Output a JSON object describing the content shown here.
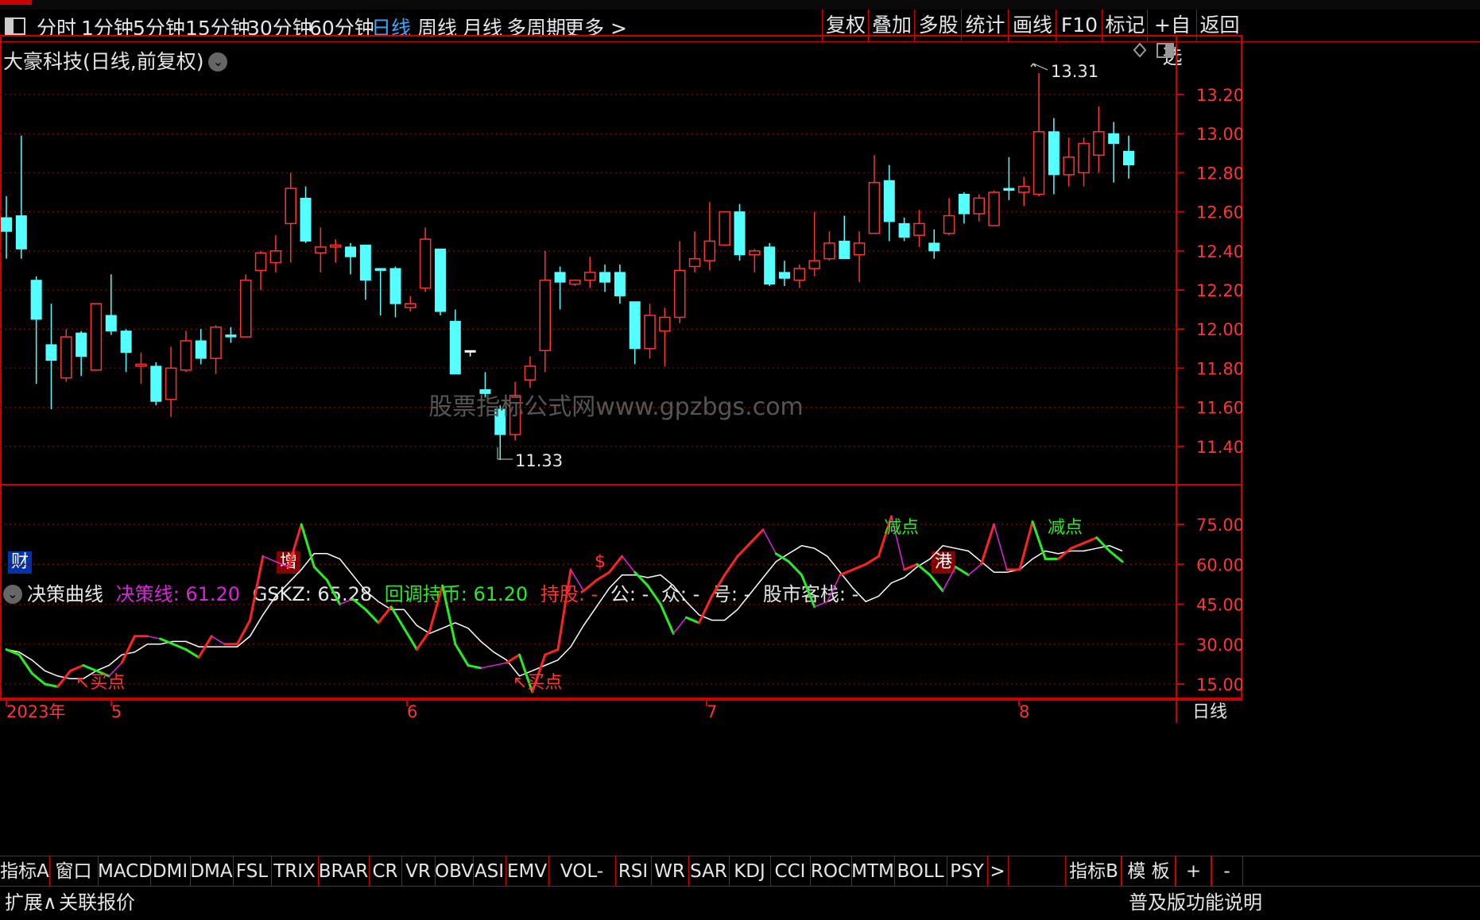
{
  "menubar": {
    "items": [
      "分时",
      "1分钟",
      "5分钟",
      "15分钟",
      "30分钟",
      "60分钟",
      "日线",
      "周线",
      "月线",
      "多周期",
      "更多 >"
    ],
    "active": "日线",
    "right_buttons": [
      "复权",
      "叠加",
      "多股",
      "统计",
      "画线",
      "F10",
      "标记",
      "+自选",
      "返回"
    ]
  },
  "main_chart": {
    "title": "大豪科技(日线,前复权)",
    "high_label": "13.31",
    "low_label": "11.33",
    "watermark": "股票指标公式网www.gpzbgs.com",
    "y_ticks": [
      "13.20",
      "13.00",
      "12.80",
      "12.60",
      "12.40",
      "12.20",
      "12.00",
      "11.80",
      "11.60",
      "11.40"
    ],
    "flags": [
      {
        "text": "财",
        "color": "#3366ff"
      },
      {
        "text": "增",
        "color": "#c00000"
      },
      {
        "text": "$",
        "color": "#c00000"
      },
      {
        "text": "港",
        "color": "#c00000"
      }
    ]
  },
  "indicator": {
    "name": "决策曲线",
    "fields": [
      {
        "label": "决策线: 61.20",
        "color": "#dd22dd"
      },
      {
        "label": "GSKZ: 65.28",
        "color": "#e6e6e6"
      },
      {
        "label": "回调持币: 61.20",
        "color": "#22ee22"
      },
      {
        "label": "持股: -",
        "color": "#ff3333"
      },
      {
        "label": "公: -",
        "color": "#e6e6e6"
      },
      {
        "label": "众: -",
        "color": "#e6e6e6"
      },
      {
        "label": "号: -",
        "color": "#e6e6e6"
      },
      {
        "label": "股市客栈: -",
        "color": "#e6e6e6"
      }
    ],
    "y_ticks": [
      "75.00",
      "60.00",
      "45.00",
      "30.00",
      "15.00"
    ],
    "annotations": [
      {
        "text": "↖买点",
        "color": "#ff3333"
      },
      {
        "text": "↖买点",
        "color": "#ff3333"
      },
      {
        "text": "减点",
        "color": "#22ee22"
      },
      {
        "text": "减点",
        "color": "#22ee22"
      }
    ]
  },
  "x_axis": {
    "labels": [
      "2023年",
      "5",
      "6",
      "7",
      "8"
    ],
    "period_label": "日线"
  },
  "bottom_tabs": [
    "指标A",
    "窗口",
    "MACD",
    "DMI",
    "DMA",
    "FSL",
    "TRIX",
    "BRAR",
    "CR",
    "VR",
    "OBV",
    "ASI",
    "EMV",
    "VOL-TDX",
    "RSI",
    "WR",
    "SAR",
    "KDJ",
    "CCI",
    "ROC",
    "MTM",
    "BOLL",
    "PSY",
    ">"
  ],
  "bottom_right_tabs": [
    "指标B",
    "模 板",
    "+",
    "-"
  ],
  "status_bar": {
    "left": [
      "扩展∧",
      "关联报价"
    ],
    "right": "普及版功能说明"
  },
  "colors": {
    "up": "#ff3333",
    "down": "#54ffff",
    "grid": "#7a0000",
    "border": "#cc0000"
  },
  "chart_data": {
    "type": "candlestick",
    "ylim": [
      11.2,
      13.4
    ],
    "candles": [
      {
        "o": 12.57,
        "c": 12.5,
        "h": 12.68,
        "l": 12.36
      },
      {
        "o": 12.58,
        "c": 12.41,
        "h": 12.99,
        "l": 12.36
      },
      {
        "o": 12.25,
        "c": 12.05,
        "h": 12.27,
        "l": 11.72
      },
      {
        "o": 11.92,
        "c": 11.84,
        "h": 12.13,
        "l": 11.59
      },
      {
        "o": 11.75,
        "c": 11.96,
        "h": 12.0,
        "l": 11.73
      },
      {
        "o": 11.98,
        "c": 11.86,
        "h": 11.99,
        "l": 11.76
      },
      {
        "o": 11.79,
        "c": 12.13,
        "h": 12.13,
        "l": 11.79
      },
      {
        "o": 12.07,
        "c": 11.99,
        "h": 12.28,
        "l": 11.97
      },
      {
        "o": 11.99,
        "c": 11.88,
        "h": 12.0,
        "l": 11.78
      },
      {
        "o": 11.81,
        "c": 11.82,
        "h": 11.88,
        "l": 11.72
      },
      {
        "o": 11.81,
        "c": 11.63,
        "h": 11.83,
        "l": 11.61
      },
      {
        "o": 11.64,
        "c": 11.8,
        "h": 11.91,
        "l": 11.55
      },
      {
        "o": 11.79,
        "c": 11.94,
        "h": 11.99,
        "l": 11.78
      },
      {
        "o": 11.94,
        "c": 11.85,
        "h": 12.0,
        "l": 11.82
      },
      {
        "o": 11.85,
        "c": 12.01,
        "h": 12.02,
        "l": 11.77
      },
      {
        "o": 11.97,
        "c": 11.96,
        "h": 12.01,
        "l": 11.93
      },
      {
        "o": 11.96,
        "c": 12.25,
        "h": 12.28,
        "l": 11.96
      },
      {
        "o": 12.3,
        "c": 12.39,
        "h": 12.4,
        "l": 12.2
      },
      {
        "o": 12.34,
        "c": 12.4,
        "h": 12.48,
        "l": 12.29
      },
      {
        "o": 12.54,
        "c": 12.72,
        "h": 12.8,
        "l": 12.34
      },
      {
        "o": 12.67,
        "c": 12.45,
        "h": 12.73,
        "l": 12.44
      },
      {
        "o": 12.39,
        "c": 12.42,
        "h": 12.52,
        "l": 12.29
      },
      {
        "o": 12.42,
        "c": 12.43,
        "h": 12.46,
        "l": 12.34
      },
      {
        "o": 12.42,
        "c": 12.37,
        "h": 12.44,
        "l": 12.28
      },
      {
        "o": 12.43,
        "c": 12.25,
        "h": 12.43,
        "l": 12.15
      },
      {
        "o": 12.31,
        "c": 12.3,
        "h": 12.31,
        "l": 12.07
      },
      {
        "o": 12.31,
        "c": 12.13,
        "h": 12.32,
        "l": 12.06
      },
      {
        "o": 12.11,
        "c": 12.13,
        "h": 12.17,
        "l": 12.09
      },
      {
        "o": 12.21,
        "c": 12.46,
        "h": 12.52,
        "l": 12.19
      },
      {
        "o": 12.41,
        "c": 12.09,
        "h": 12.41,
        "l": 12.07
      },
      {
        "o": 12.04,
        "c": 11.77,
        "h": 12.1,
        "l": 11.77
      },
      {
        "o": 11.89,
        "c": 11.89,
        "h": 11.82,
        "l": 11.86
      },
      {
        "o": 11.69,
        "c": 11.67,
        "h": 11.78,
        "l": 11.65
      },
      {
        "o": 11.59,
        "c": 11.46,
        "h": 11.61,
        "l": 11.33
      },
      {
        "o": 11.46,
        "c": 11.66,
        "h": 11.73,
        "l": 11.43
      },
      {
        "o": 11.74,
        "c": 11.81,
        "h": 11.86,
        "l": 11.7
      },
      {
        "o": 11.89,
        "c": 12.25,
        "h": 12.4,
        "l": 11.78
      },
      {
        "o": 12.29,
        "c": 12.24,
        "h": 12.32,
        "l": 12.1
      },
      {
        "o": 12.23,
        "c": 12.25,
        "h": 12.25,
        "l": 12.22
      },
      {
        "o": 12.25,
        "c": 12.29,
        "h": 12.37,
        "l": 12.21
      },
      {
        "o": 12.29,
        "c": 12.24,
        "h": 12.33,
        "l": 12.19
      },
      {
        "o": 12.29,
        "c": 12.17,
        "h": 12.33,
        "l": 12.13
      },
      {
        "o": 12.14,
        "c": 11.9,
        "h": 12.14,
        "l": 11.82
      },
      {
        "o": 11.9,
        "c": 12.07,
        "h": 12.13,
        "l": 11.85
      },
      {
        "o": 11.99,
        "c": 12.06,
        "h": 12.11,
        "l": 11.81
      },
      {
        "o": 12.06,
        "c": 12.3,
        "h": 12.45,
        "l": 12.03
      },
      {
        "o": 12.32,
        "c": 12.36,
        "h": 12.5,
        "l": 12.29
      },
      {
        "o": 12.35,
        "c": 12.45,
        "h": 12.65,
        "l": 12.3
      },
      {
        "o": 12.43,
        "c": 12.6,
        "h": 12.6,
        "l": 12.43
      },
      {
        "o": 12.6,
        "c": 12.38,
        "h": 12.64,
        "l": 12.35
      },
      {
        "o": 12.38,
        "c": 12.4,
        "h": 12.41,
        "l": 12.29
      },
      {
        "o": 12.42,
        "c": 12.23,
        "h": 12.44,
        "l": 12.22
      },
      {
        "o": 12.29,
        "c": 12.26,
        "h": 12.35,
        "l": 12.22
      },
      {
        "o": 12.25,
        "c": 12.31,
        "h": 12.33,
        "l": 12.21
      },
      {
        "o": 12.31,
        "c": 12.35,
        "h": 12.6,
        "l": 12.27
      },
      {
        "o": 12.36,
        "c": 12.44,
        "h": 12.5,
        "l": 12.35
      },
      {
        "o": 12.45,
        "c": 12.36,
        "h": 12.58,
        "l": 12.36
      },
      {
        "o": 12.38,
        "c": 12.44,
        "h": 12.5,
        "l": 12.24
      },
      {
        "o": 12.49,
        "c": 12.75,
        "h": 12.89,
        "l": 12.49
      },
      {
        "o": 12.76,
        "c": 12.55,
        "h": 12.84,
        "l": 12.45
      },
      {
        "o": 12.54,
        "c": 12.47,
        "h": 12.57,
        "l": 12.45
      },
      {
        "o": 12.48,
        "c": 12.54,
        "h": 12.61,
        "l": 12.42
      },
      {
        "o": 12.44,
        "c": 12.4,
        "h": 12.51,
        "l": 12.36
      },
      {
        "o": 12.49,
        "c": 12.58,
        "h": 12.67,
        "l": 12.48
      },
      {
        "o": 12.69,
        "c": 12.59,
        "h": 12.7,
        "l": 12.54
      },
      {
        "o": 12.59,
        "c": 12.67,
        "h": 12.69,
        "l": 12.55
      },
      {
        "o": 12.53,
        "c": 12.7,
        "h": 12.71,
        "l": 12.53
      },
      {
        "o": 12.72,
        "c": 12.71,
        "h": 12.88,
        "l": 12.66
      },
      {
        "o": 12.7,
        "c": 12.73,
        "h": 12.78,
        "l": 12.63
      },
      {
        "o": 12.69,
        "c": 13.01,
        "h": 13.31,
        "l": 12.68
      },
      {
        "o": 13.01,
        "c": 12.79,
        "h": 13.08,
        "l": 12.69
      },
      {
        "o": 12.79,
        "c": 12.88,
        "h": 12.98,
        "l": 12.73
      },
      {
        "o": 12.8,
        "c": 12.95,
        "h": 12.98,
        "l": 12.73
      },
      {
        "o": 12.89,
        "c": 13.01,
        "h": 13.14,
        "l": 12.8
      },
      {
        "o": 13.0,
        "c": 12.95,
        "h": 13.06,
        "l": 12.75
      },
      {
        "o": 12.91,
        "c": 12.84,
        "h": 12.99,
        "l": 12.77
      }
    ],
    "indicator_series": {
      "ylim": [
        10,
        85
      ],
      "decision_line": [
        28,
        26,
        19,
        15,
        14,
        20,
        22,
        20,
        18,
        23,
        33,
        33,
        32,
        30,
        28,
        25,
        33,
        30,
        30,
        39,
        63,
        61,
        59,
        75,
        59,
        54,
        45,
        47,
        43,
        38,
        44,
        36,
        28,
        35,
        52,
        30,
        22,
        21,
        22,
        23,
        26,
        12,
        26,
        28,
        58,
        50,
        54,
        57,
        63,
        57,
        52,
        45,
        34,
        40,
        38,
        48,
        56,
        63,
        68,
        73,
        64,
        61,
        56,
        44,
        46,
        56,
        58,
        60,
        63,
        78,
        58,
        60,
        56,
        50,
        59,
        56,
        60,
        75,
        58,
        58,
        76,
        62,
        62,
        66,
        68,
        70,
        65,
        61
      ],
      "gskz": [
        28,
        27,
        24,
        20,
        18,
        17,
        17,
        20,
        22,
        26,
        27,
        30,
        30,
        31,
        31,
        29,
        29,
        29,
        29,
        33,
        41,
        48,
        53,
        58,
        64,
        64,
        62,
        56,
        50,
        46,
        43,
        43,
        37,
        34,
        36,
        38,
        36,
        31,
        27,
        24,
        18,
        20,
        22,
        24,
        29,
        37,
        44,
        51,
        56,
        56,
        55,
        56,
        52,
        46,
        41,
        39,
        39,
        43,
        49,
        55,
        61,
        64,
        67,
        66,
        63,
        57,
        51,
        46,
        48,
        53,
        55,
        59,
        62,
        67,
        66,
        65,
        61,
        57,
        57,
        58,
        62,
        65,
        64,
        65,
        65,
        66,
        67,
        65
      ]
    }
  }
}
